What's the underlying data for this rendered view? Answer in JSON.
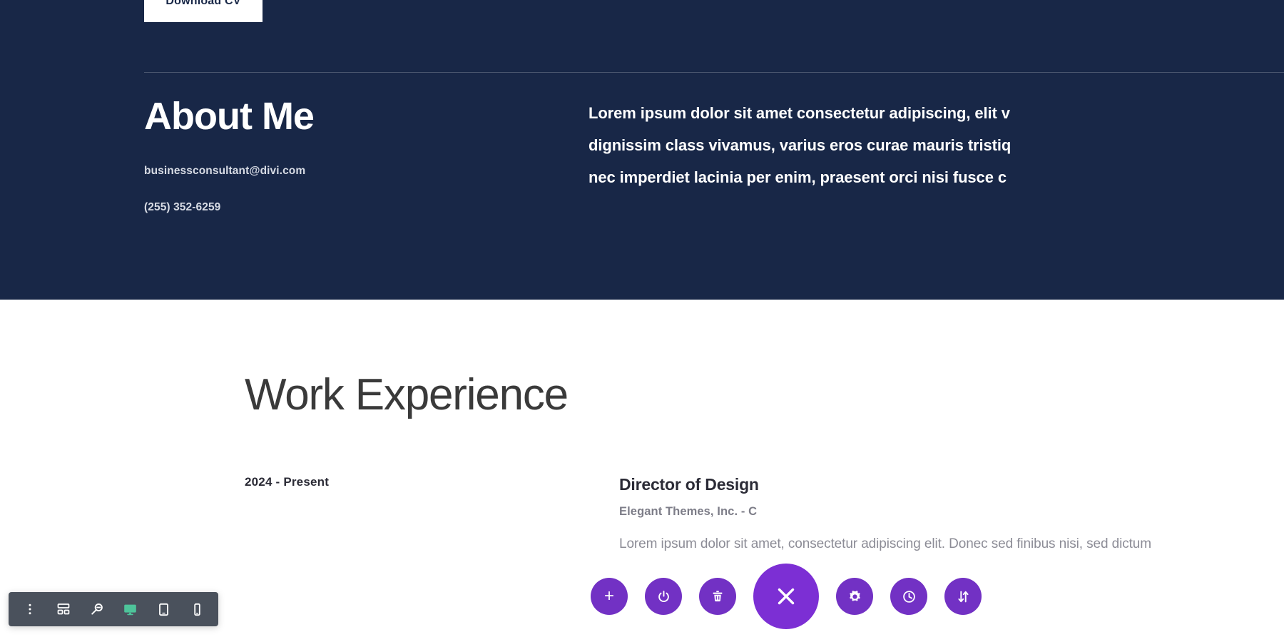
{
  "hero": {
    "download_cv_label": "Download CV",
    "about_title": "About Me",
    "email": "businessconsultant@divi.com",
    "phone": "(255) 352-6259",
    "body_line1": "Lorem ipsum dolor sit amet consectetur adipiscing, elit v",
    "body_line2": "dignissim class vivamus, varius eros curae mauris tristiq",
    "body_line3": "nec imperdiet lacinia per enim, praesent orci nisi fusce c"
  },
  "work": {
    "section_title": "Work Experience",
    "entry": {
      "date": "2024 - Present",
      "job_title": "Director of Design",
      "company": "Elegant Themes, Inc. - C",
      "description": "Lorem ipsum dolor sit amet, consectetur adipiscing elit. Donec sed finibus nisi, sed dictum"
    }
  },
  "builder_bar": {
    "items": [
      {
        "icon": "kebab-menu-icon",
        "name": "builder-menu-button"
      },
      {
        "icon": "wireframe-icon",
        "name": "wireframe-view-button"
      },
      {
        "icon": "zoom-out-icon",
        "name": "zoom-view-button"
      },
      {
        "icon": "desktop-icon",
        "name": "desktop-view-button",
        "active": true
      },
      {
        "icon": "tablet-icon",
        "name": "tablet-view-button"
      },
      {
        "icon": "phone-icon",
        "name": "phone-view-button"
      }
    ]
  },
  "fab_row": {
    "buttons": [
      {
        "icon": "plus-icon",
        "name": "add-module-button"
      },
      {
        "icon": "power-icon",
        "name": "disable-module-button"
      },
      {
        "icon": "trash-icon",
        "name": "delete-module-button"
      },
      {
        "icon": "close-icon",
        "name": "close-builder-button",
        "main": true
      },
      {
        "icon": "gear-icon",
        "name": "settings-button"
      },
      {
        "icon": "clock-icon",
        "name": "history-button"
      },
      {
        "icon": "sort-arrows-icon",
        "name": "move-module-button"
      }
    ]
  },
  "colors": {
    "navy": "#182747",
    "purple": "#7231c4",
    "purple_main": "#7c2fd4",
    "bar": "#4a515c",
    "accent_green": "#4ec49a"
  }
}
